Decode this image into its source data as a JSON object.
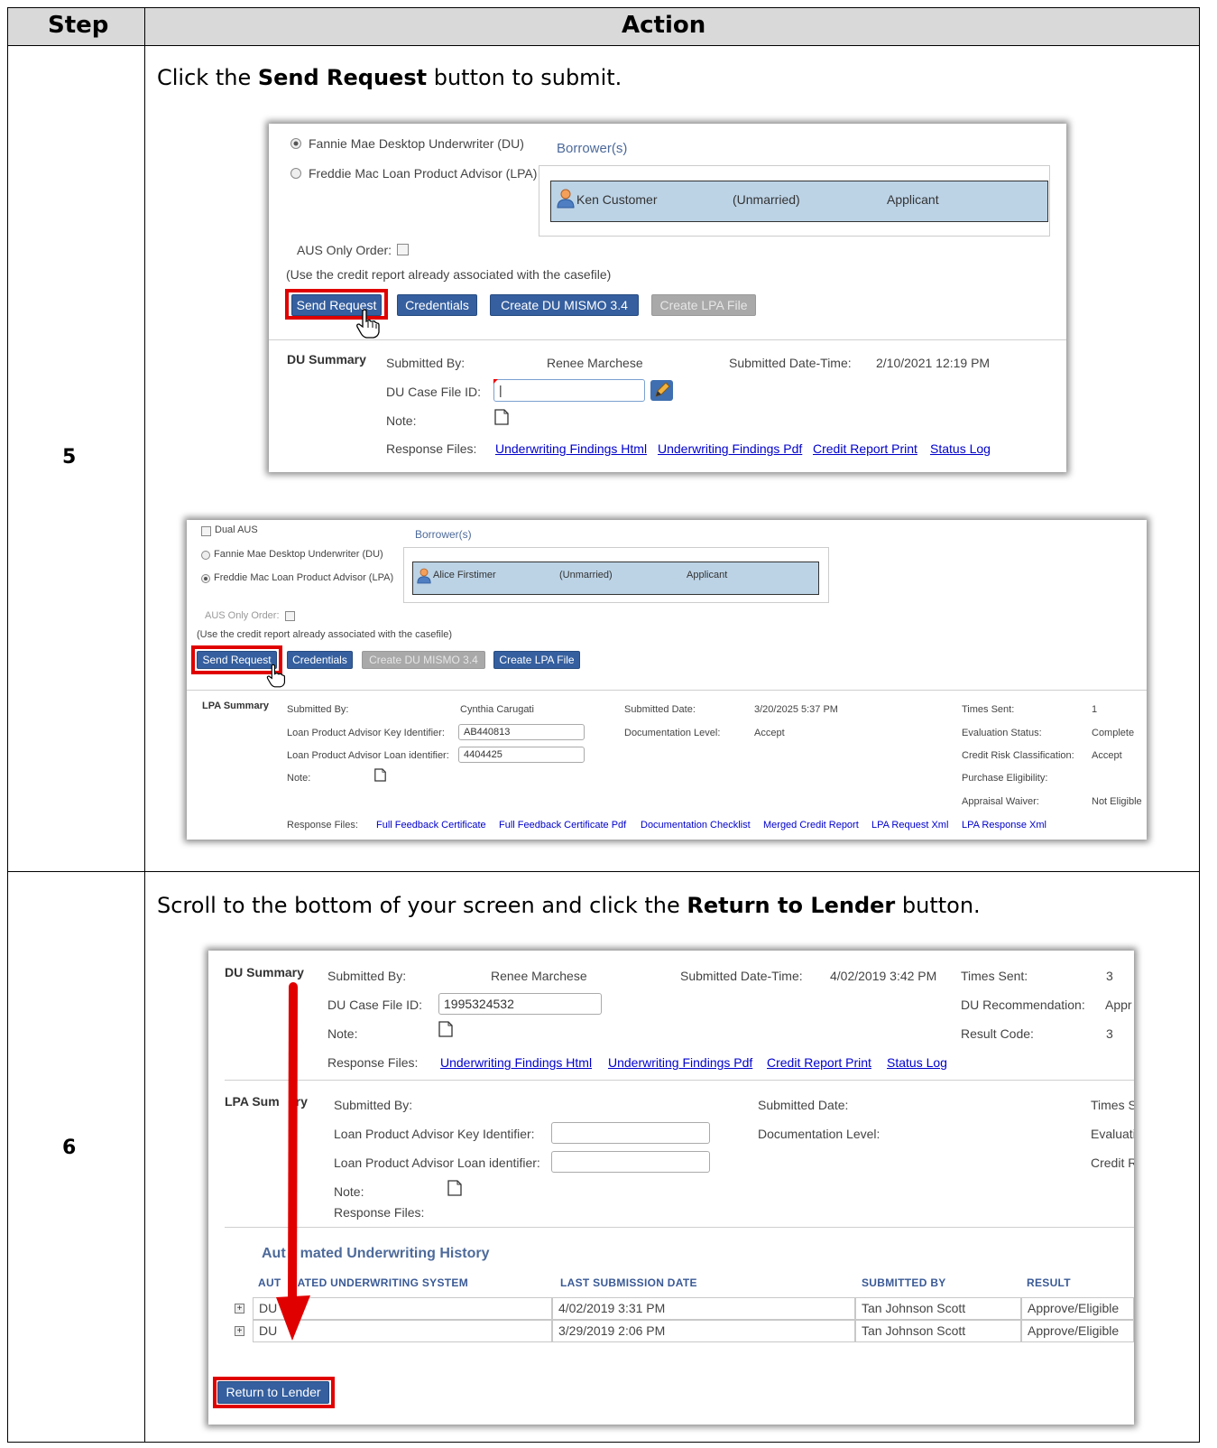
{
  "table": {
    "col_step": "Step",
    "col_action": "Action"
  },
  "step5": {
    "number": "5",
    "instruction_pre": "Click the ",
    "instruction_bold": "Send Request",
    "instruction_post": " button to submit.",
    "shot1": {
      "radio_du": "Fannie Mae Desktop Underwriter (DU)",
      "radio_lpa": "Freddie Mac Loan Product Advisor (LPA)",
      "selected": "du",
      "borrowers_title": "Borrower(s)",
      "borrower": {
        "name": "Ken Customer",
        "status": "(Unmarried)",
        "role": "Applicant"
      },
      "aus_only": "AUS Only Order:",
      "credit_note": "(Use the credit report already associated with the casefile)",
      "buttons": {
        "send": "Send Request",
        "credentials": "Credentials",
        "create_du": "Create DU MISMO 3.4",
        "create_lpa": "Create LPA File"
      },
      "summary_title": "DU Summary",
      "submitted_by_label": "Submitted By:",
      "submitted_by": "Renee Marchese",
      "submitted_dt_label": "Submitted Date-Time:",
      "submitted_dt": "2/10/2021 12:19 PM",
      "case_id_label": "DU Case File ID:",
      "case_id": "|",
      "note_label": "Note:",
      "response_label": "Response Files:",
      "files": [
        "Underwriting Findings Html",
        "Underwriting Findings Pdf",
        "Credit Report Print",
        "Status Log"
      ]
    },
    "shot2": {
      "dual_aus": "Dual AUS",
      "radio_du": "Fannie Mae Desktop Underwriter (DU)",
      "radio_lpa": "Freddie Mac Loan Product Advisor (LPA)",
      "selected": "lpa",
      "borrowers_title": "Borrower(s)",
      "borrower": {
        "name": "Alice Firstimer",
        "status": "(Unmarried)",
        "role": "Applicant"
      },
      "aus_only": "AUS Only Order:",
      "credit_note": "(Use the credit report already associated with the casefile)",
      "buttons": {
        "send": "Send Request",
        "credentials": "Credentials",
        "create_du": "Create DU MISMO 3.4",
        "create_lpa": "Create LPA File"
      },
      "summary_title": "LPA Summary",
      "submitted_by_label": "Submitted By:",
      "submitted_by": "Cynthia Carugati",
      "submitted_date_label": "Submitted Date:",
      "submitted_date": "3/20/2025 5:37 PM",
      "times_sent_label": "Times Sent:",
      "times_sent": "1",
      "key_id_label": "Loan Product Advisor Key Identifier:",
      "key_id": "AB440813",
      "doc_level_label": "Documentation Level:",
      "doc_level": "Accept",
      "eval_status_label": "Evaluation Status:",
      "eval_status": "Complete",
      "loan_id_label": "Loan Product Advisor Loan identifier:",
      "loan_id": "4404425",
      "credit_risk_label": "Credit Risk Classification:",
      "credit_risk": "Accept",
      "note_label": "Note:",
      "purchase_label": "Purchase Eligibility:",
      "appraisal_label": "Appraisal Waiver:",
      "appraisal": "Not Eligible",
      "response_label": "Response Files:",
      "files": [
        "Full Feedback Certificate",
        "Full Feedback Certificate Pdf",
        "Documentation Checklist",
        "Merged Credit Report",
        "LPA Request Xml",
        "LPA Response Xml"
      ]
    }
  },
  "step6": {
    "number": "6",
    "instruction_pre": "Scroll to the bottom of your screen and click the ",
    "instruction_bold": "Return to Lender",
    "instruction_post": " button.",
    "shot3": {
      "du_title": "DU Summary",
      "submitted_by_label": "Submitted By:",
      "submitted_by": "Renee Marchese",
      "submitted_dt_label": "Submitted Date-Time:",
      "submitted_dt": "4/02/2019 3:42 PM",
      "times_sent_label": "Times Sent:",
      "times_sent": "3",
      "case_id_label": "DU Case File ID:",
      "case_id": "1995324532",
      "du_rec_label": "DU Recommendation:",
      "du_rec": "Appr",
      "note_label": "Note:",
      "result_code_label": "Result Code:",
      "result_code": "3",
      "response_label": "Response Files:",
      "files": [
        "Underwriting Findings Html",
        "Underwriting Findings Pdf",
        "Credit Report Print",
        "Status Log"
      ],
      "lpa_title_a": "LPA Sum",
      "lpa_title_b": "ry",
      "lpa_submitted_by_label": "Submitted By:",
      "lpa_submitted_date_label": "Submitted Date:",
      "lpa_times_label": "Times S",
      "lpa_key_label": "Loan Product Advisor Key Identifier:",
      "lpa_doc_label": "Documentation Level:",
      "lpa_eval_label": "Evaluati",
      "lpa_loan_label": "Loan Product Advisor Loan identifier:",
      "lpa_credit_label": "Credit R",
      "lpa_note_label": "Note:",
      "lpa_response_label": "Response Files:",
      "history_title_a": "Aut",
      "history_title_b": "mated Underwriting History",
      "history_cols": [
        "AUT",
        "ATED UNDERWRITING SYSTEM",
        "LAST SUBMISSION DATE",
        "SUBMITTED BY",
        "RESULT"
      ],
      "history_rows": [
        {
          "system": "DU",
          "date": "4/02/2019 3:31 PM",
          "by": "Tan Johnson Scott",
          "result": "Approve/Eligible"
        },
        {
          "system": "DU",
          "date": "3/29/2019 2:06 PM",
          "by": "Tan Johnson Scott",
          "result": "Approve/Eligible"
        }
      ],
      "return_btn": "Return to Lender"
    }
  },
  "colors": {
    "button": "#355f9f",
    "highlight": "#e00000",
    "link": "#0000cc",
    "borrower_row": "#bcd3e6",
    "arrow": "#e00000"
  }
}
